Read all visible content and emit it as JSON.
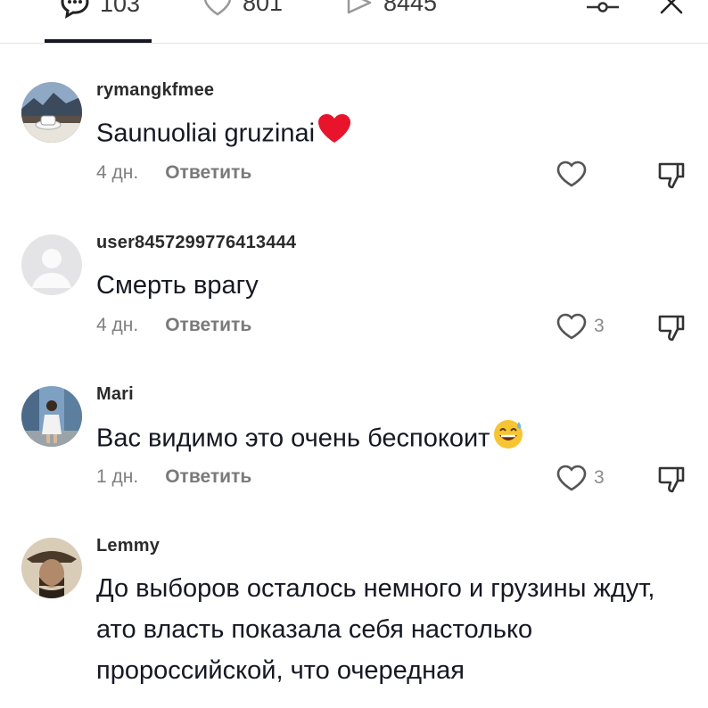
{
  "header": {
    "comments_count": "103",
    "likes_count": "801",
    "shares_count": "8445"
  },
  "comments": [
    {
      "username": "rymangkfmee",
      "text": "Saunuoliai gruzinai",
      "emoji": "red-heart",
      "time": "4 дн.",
      "reply_label": "Ответить",
      "like_count": ""
    },
    {
      "username": "user8457299776413444",
      "text": "Смерть врагу",
      "emoji": "",
      "time": "4 дн.",
      "reply_label": "Ответить",
      "like_count": "3"
    },
    {
      "username": "Mari",
      "text": "Вас видимо это очень беспокоит",
      "emoji": "grinning-sweat",
      "time": "1 дн.",
      "reply_label": "Ответить",
      "like_count": "3"
    },
    {
      "username": "Lemmy",
      "text": "До выборов осталось немного и грузины ждут, ато власть показала себя настолько пророссийской, что очередная",
      "emoji": "",
      "time": "",
      "reply_label": "",
      "like_count": ""
    }
  ],
  "colors": {
    "text": "#161823",
    "muted": "#808080",
    "heart": "#e8142b",
    "divider": "#e3e3e3"
  }
}
